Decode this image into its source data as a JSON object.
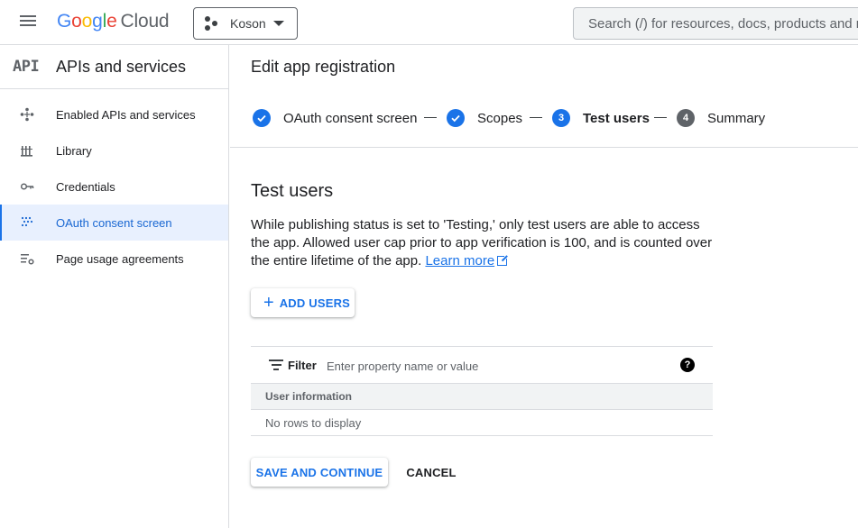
{
  "topbar": {
    "logo": {
      "g1": "G",
      "g2": "o",
      "g3": "o",
      "g4": "g",
      "g5": "l",
      "g6": "e",
      "cloud": "Cloud"
    },
    "project_name": "Koson",
    "search_placeholder": "Search (/) for resources, docs, products and more"
  },
  "sidebar": {
    "icon_text": "API",
    "title": "APIs and services",
    "items": [
      {
        "label": "Enabled APIs and services",
        "icon": "api-diamond-icon",
        "active": false
      },
      {
        "label": "Library",
        "icon": "library-icon",
        "active": false
      },
      {
        "label": "Credentials",
        "icon": "key-icon",
        "active": false
      },
      {
        "label": "OAuth consent screen",
        "icon": "consent-dots-icon",
        "active": true
      },
      {
        "label": "Page usage agreements",
        "icon": "settings-list-icon",
        "active": false
      }
    ]
  },
  "main": {
    "title": "Edit app registration",
    "steps": [
      {
        "label": "OAuth consent screen",
        "state": "done",
        "num": ""
      },
      {
        "label": "Scopes",
        "state": "done",
        "num": ""
      },
      {
        "label": "Test users",
        "state": "current",
        "num": "3"
      },
      {
        "label": "Summary",
        "state": "future",
        "num": "4"
      }
    ],
    "section_title": "Test users",
    "description": "While publishing status is set to 'Testing,' only test users are able to access the app. Allowed user cap prior to app verification is 100, and is counted over the entire lifetime of the app.",
    "learn_more": "Learn more",
    "add_users_label": "ADD USERS",
    "table": {
      "filter_label": "Filter",
      "filter_placeholder": "Enter property name or value",
      "help": "?",
      "column_header": "User information",
      "empty_text": "No rows to display"
    },
    "save_label": "SAVE AND CONTINUE",
    "cancel_label": "CANCEL"
  },
  "colors": {
    "accent": "#1a73e8",
    "active_bg": "#e8f0fe",
    "border": "#dadce0",
    "step_future": "#5f6368"
  }
}
